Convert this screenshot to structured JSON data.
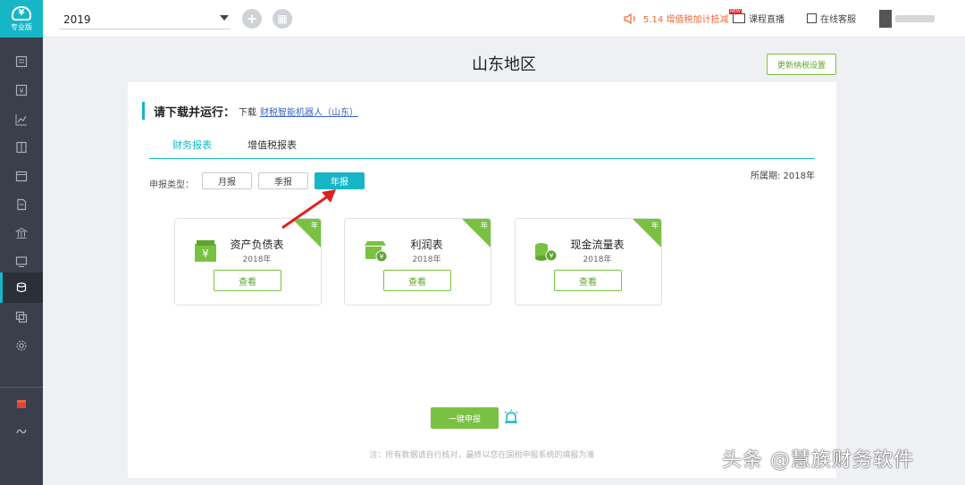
{
  "app": {
    "logo_label": "专业版",
    "logo_glyph": "¥"
  },
  "sidebar": {
    "items": [
      {
        "icon": "ledger-icon"
      },
      {
        "icon": "voucher-icon"
      },
      {
        "icon": "chart-icon"
      },
      {
        "icon": "book-icon"
      },
      {
        "icon": "calendar-icon"
      },
      {
        "icon": "document-icon"
      },
      {
        "icon": "bank-icon"
      },
      {
        "icon": "monitor-icon"
      },
      {
        "icon": "tax-declare-icon",
        "active": true
      },
      {
        "icon": "copy-icon"
      },
      {
        "icon": "gear-icon"
      }
    ],
    "bottom_items": [
      {
        "icon": "gift-icon"
      },
      {
        "icon": "service-icon"
      }
    ]
  },
  "topbar": {
    "year_value": "2019",
    "add_icon": "+",
    "grid_icon": "▦",
    "notice_text": "5.14 增值税加计抵减",
    "live_course": "课程直播",
    "live_badge": "NEW",
    "online_service": "在线客服"
  },
  "main": {
    "region_title": "山东地区",
    "tax_settings_button": "更新纳税设置",
    "download_heading": "请下载并运行：",
    "download_prefix": "下载",
    "download_link": "财税智能机器人（山东）",
    "tabs": [
      {
        "label": "财务报表",
        "active": true
      },
      {
        "label": "增值税报表",
        "active": false
      }
    ],
    "period_label": "申报类型：",
    "period_options": [
      {
        "label": "月报",
        "active": false
      },
      {
        "label": "季报",
        "active": false
      },
      {
        "label": "年报",
        "active": true
      }
    ],
    "period_info": "所属期: 2018年",
    "cards": [
      {
        "title": "资产负债表",
        "year": "2018年",
        "view": "查看",
        "corner": "年",
        "icon": "balance-sheet-icon"
      },
      {
        "title": "利润表",
        "year": "2018年",
        "view": "查看",
        "corner": "年",
        "icon": "income-statement-icon"
      },
      {
        "title": "现金流量表",
        "year": "2018年",
        "view": "查看",
        "corner": "年",
        "icon": "cash-flow-icon"
      }
    ],
    "one_click_button": "一键申报",
    "footnote": "注：所有数据请自行核对，最终以您在国税申报系统的填报为准"
  },
  "watermark": "头条 @慧族财务软件",
  "colors": {
    "accent": "#17b6c6",
    "green": "#7ac143",
    "sidebar": "#3a3f4b",
    "notice": "#f06a3a",
    "arrow": "#e02020"
  }
}
